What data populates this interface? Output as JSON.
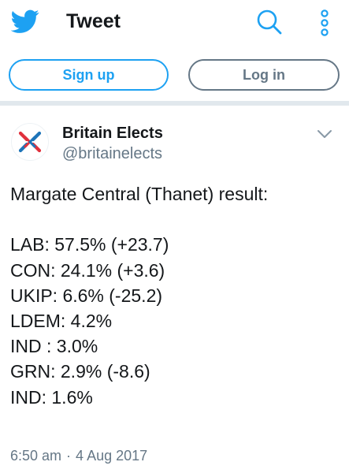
{
  "header": {
    "title": "Tweet",
    "logo_icon": "twitter-bird-icon",
    "search_icon": "search-icon",
    "menu_icon": "more-vertical-icon",
    "brand_color": "#1da1f2"
  },
  "auth": {
    "signup_label": "Sign up",
    "login_label": "Log in"
  },
  "tweet": {
    "author": {
      "name": "Britain Elects",
      "handle": "@britainelects",
      "avatar_icon": "britain-elects-logo-icon"
    },
    "text_intro": "Margate Central (Thanet) result:",
    "results": [
      "LAB: 57.5% (+23.7)",
      "CON: 24.1% (+3.6)",
      "UKIP: 6.6% (-25.2)",
      "LDEM: 4.2%",
      "IND : 3.0%",
      "GRN: 2.9% (-8.6)",
      "IND: 1.6%"
    ],
    "time": "6:50 am",
    "separator": "·",
    "date": "4 Aug 2017",
    "caret_icon": "chevron-down-icon"
  },
  "colors": {
    "text_primary": "#14171a",
    "text_secondary": "#657786",
    "divider": "#e1e8ed",
    "logo_red": "#e0303c",
    "logo_blue": "#1d74b8"
  }
}
